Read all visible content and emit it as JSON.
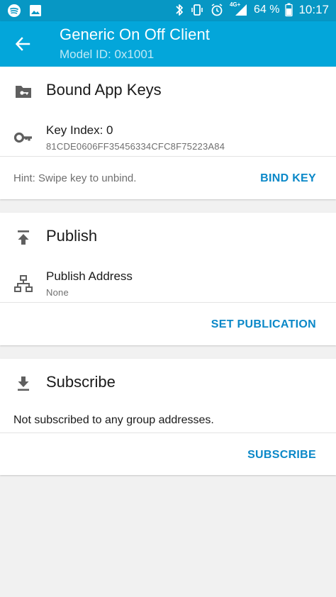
{
  "status_bar": {
    "network": "4G+",
    "battery": "64 %",
    "time": "10:17"
  },
  "app_bar": {
    "title": "Generic On Off Client",
    "subtitle": "Model ID: 0x1001"
  },
  "bound_app_keys": {
    "title": "Bound App Keys",
    "key_label": "Key Index: 0",
    "key_value": "81CDE0606FF35456334CFC8F75223A84",
    "hint": "Hint: Swipe key to unbind.",
    "action": "BIND KEY"
  },
  "publish": {
    "title": "Publish",
    "address_label": "Publish Address",
    "address_value": "None",
    "action": "SET PUBLICATION"
  },
  "subscribe": {
    "title": "Subscribe",
    "message": "Not subscribed to any group addresses.",
    "action": "SUBSCRIBE"
  },
  "colors": {
    "status_bar": "#0797c4",
    "app_bar": "#03a6da",
    "accent": "#0a88c8",
    "icon": "#5f5f5f"
  },
  "icons": {
    "status_left": [
      "spotify-icon",
      "image-icon"
    ],
    "status_right": [
      "bluetooth-icon",
      "vibrate-icon",
      "alarm-icon",
      "signal-icon",
      "battery-icon"
    ],
    "back": "arrow-left-icon",
    "keys_header": "folder-key-icon",
    "key_row": "key-icon",
    "publish_header": "publish-icon",
    "publish_row": "network-icon",
    "subscribe_header": "download-icon"
  }
}
